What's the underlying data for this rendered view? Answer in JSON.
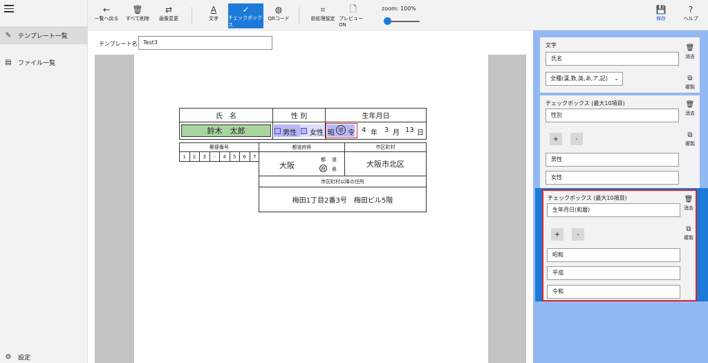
{
  "nav": {
    "items": [
      {
        "label": "テンプレート一覧",
        "icon": "template-list-icon"
      },
      {
        "label": "ファイル一覧",
        "icon": "file-list-icon"
      }
    ],
    "settings": "設定"
  },
  "toolbar": {
    "back": "一覧へ戻る",
    "delete_all": "すべて削除",
    "change_image": "画像変更",
    "text": "文字",
    "checkbox": "チェックボックス",
    "qr": "QRコード",
    "preprocess": "前処理設定",
    "preview": "プレビューON",
    "zoom": "zoom:  100%",
    "save": "保存",
    "help": "ヘルプ",
    "accent_color": "#1e7ad8"
  },
  "template": {
    "name_label": "テンプレート名：",
    "name_value": "Test3"
  },
  "form": {
    "h_name": "氏　名",
    "h_gender": "性 別",
    "h_birth": "生年月日",
    "name_value": "鈴木　太郎",
    "male": "男性",
    "female": "女性",
    "era_showa": "昭",
    "era_heisei": "平",
    "era_reiwa": "令",
    "birth_year": "4",
    "year_unit": "年",
    "birth_month": "3",
    "month_unit": "月",
    "birth_day": "13",
    "day_unit": "日",
    "h_postal": "郵便番号",
    "h_pref": "都道府県",
    "h_city": "市区町村",
    "postal_digits": [
      "1",
      "2",
      "3",
      "-",
      "4",
      "5",
      "6",
      "7"
    ],
    "pref_value": "大阪",
    "suffix_to": "都",
    "suffix_michi": "道",
    "suffix_fu": "府",
    "suffix_ken": "県",
    "city_value": "大阪市北区",
    "h_address": "市区町村以降の住所",
    "address_value": "梅田1丁目2番3号　梅田ビル5階",
    "highlight_green": "#a9d4a0",
    "highlight_blue": "#b8b8f8",
    "selection_red": "#d8222e"
  },
  "panel": {
    "bg_color": "#93b9f4",
    "delete_label": "消去",
    "copy_label": "複製",
    "plus": "+",
    "minus": "-",
    "card1": {
      "title": "文字",
      "field": "氏名",
      "select": "全種(漢,数,英,あ,ア,記)"
    },
    "card2": {
      "title": "チェックボックス (最大10項目)",
      "field": "性別",
      "items": [
        "男性",
        "女性"
      ]
    },
    "card3": {
      "title": "チェックボックス (最大10項目)",
      "field": "生年月日(和暦)",
      "items": [
        "昭和",
        "平成",
        "令和"
      ]
    }
  }
}
